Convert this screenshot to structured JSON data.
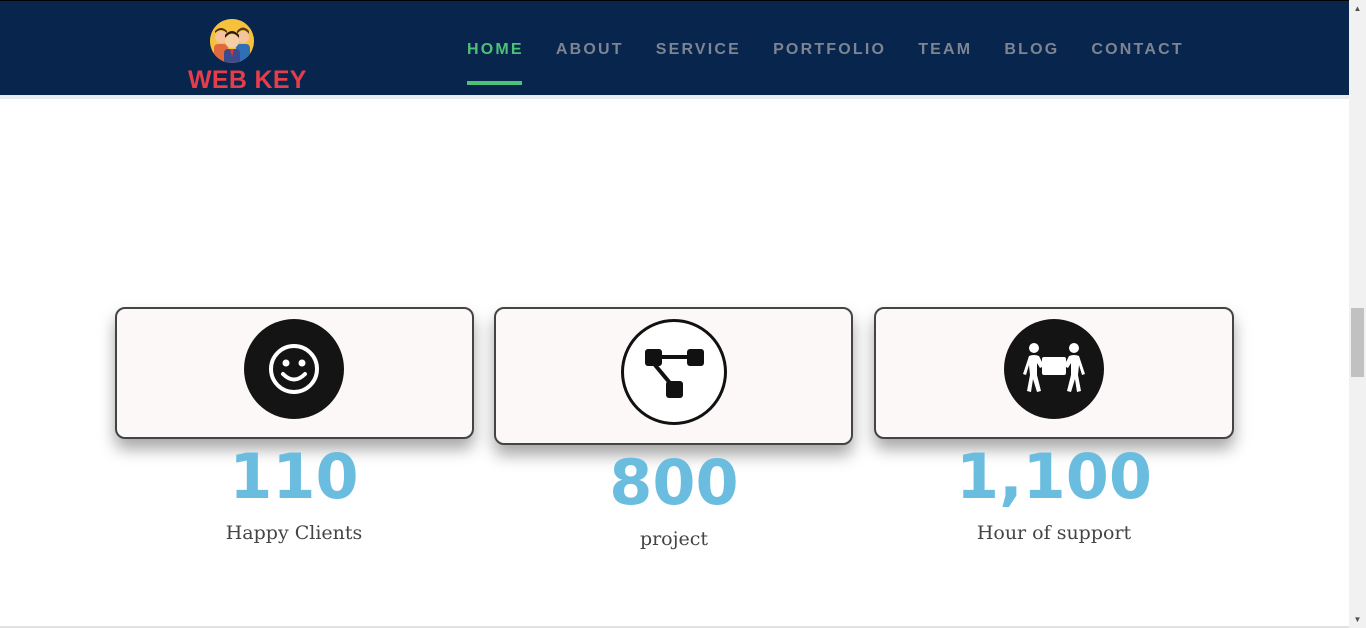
{
  "brand": {
    "name": "WEB KEY",
    "name_color": "#e63d4a"
  },
  "nav": {
    "items": [
      {
        "label": "HOME",
        "active": true
      },
      {
        "label": "ABOUT",
        "active": false
      },
      {
        "label": "SERVICE",
        "active": false
      },
      {
        "label": "PORTFOLIO",
        "active": false
      },
      {
        "label": "TEAM",
        "active": false
      },
      {
        "label": "BLOG",
        "active": false
      },
      {
        "label": "CONTACT",
        "active": false
      }
    ],
    "background": "#08254e",
    "active_color": "#4ec178"
  },
  "stats": [
    {
      "icon": "smiley-icon",
      "value": "110",
      "label": "Happy Clients"
    },
    {
      "icon": "workflow-icon",
      "value": "800",
      "label": "project"
    },
    {
      "icon": "support-people-icon",
      "value": "1,100",
      "label": "Hour of support"
    }
  ],
  "colors": {
    "stat_number": "#6bbde0",
    "card_background": "#fcf8f8"
  }
}
